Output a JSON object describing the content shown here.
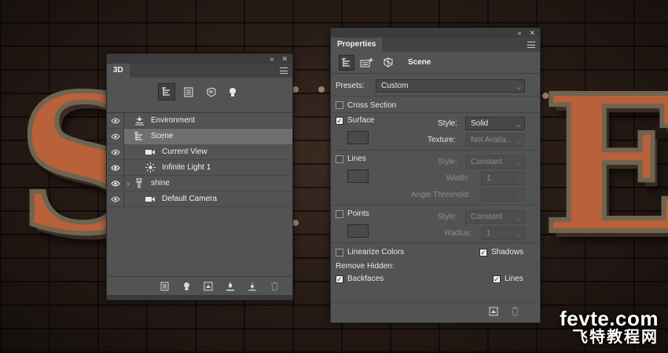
{
  "background": {
    "letter_left": "S",
    "letter_right": "E",
    "watermark_line1": "fevte.com",
    "watermark_line2": "飞特教程网"
  },
  "panel_3d": {
    "tab_label": "3D",
    "filter_icons": [
      "scene-filter-icon",
      "mesh-filter-icon",
      "material-filter-icon",
      "light-filter-icon"
    ],
    "layers": [
      {
        "name": "Environment",
        "icon": "environment-icon",
        "visible": true
      },
      {
        "name": "Scene",
        "icon": "scene-icon",
        "visible": true,
        "selected": true
      },
      {
        "name": "Current View",
        "icon": "camera-icon",
        "visible": true
      },
      {
        "name": "Infinite Light 1",
        "icon": "infinite-light-icon",
        "visible": true
      },
      {
        "name": "shine",
        "icon": "mesh-icon",
        "visible": true,
        "expandable": true
      },
      {
        "name": "Default Camera",
        "icon": "camera-icon",
        "visible": true
      }
    ],
    "bottom_icons": [
      "mesh-dropdown-icon",
      "light-dropdown-icon",
      "render-icon",
      "move-to-ground-icon",
      "add-light-icon",
      "delete-icon"
    ]
  },
  "panel_properties": {
    "tab_label": "Properties",
    "header_title": "Scene",
    "presets_label": "Presets:",
    "presets_value": "Custom",
    "cross_section_label": "Cross Section",
    "cross_section_checked": false,
    "surface": {
      "label": "Surface",
      "checked": true,
      "style_label": "Style:",
      "style_value": "Solid",
      "texture_label": "Texture:",
      "texture_value": "Not Availa..."
    },
    "lines": {
      "label": "Lines",
      "checked": false,
      "style_label": "Style:",
      "style_value": "Constant",
      "width_label": "Width:",
      "width_value": "1",
      "angle_label": "Angle Threshold:",
      "angle_value": ""
    },
    "points": {
      "label": "Points",
      "checked": false,
      "style_label": "Style:",
      "style_value": "Constant",
      "radius_label": "Radius:",
      "radius_value": "1"
    },
    "linearize_label": "Linearize Colors",
    "linearize_checked": false,
    "shadows_label": "Shadows",
    "shadows_checked": true,
    "remove_hidden_label": "Remove Hidden:",
    "backfaces_label": "Backfaces",
    "backfaces_checked": true,
    "hidden_lines_label": "Lines",
    "hidden_lines_checked": true
  }
}
